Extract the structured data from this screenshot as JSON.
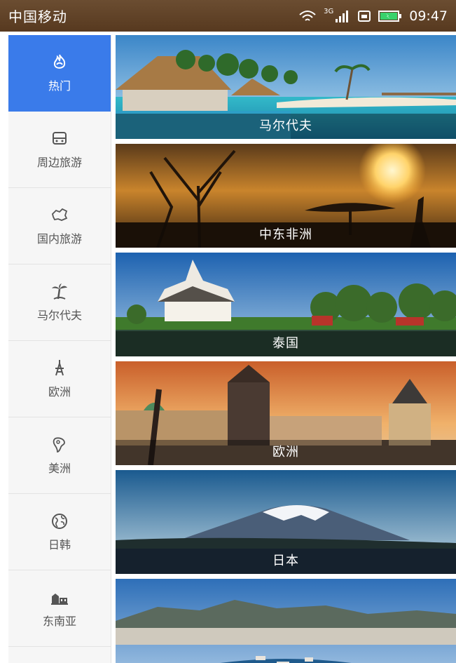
{
  "status": {
    "carrier": "中国移动",
    "network": "3G",
    "time": "09:47"
  },
  "sidebar": {
    "items": [
      {
        "label": "热门",
        "icon": "fire-icon",
        "active": true
      },
      {
        "label": "周边旅游",
        "icon": "bus-icon"
      },
      {
        "label": "国内旅游",
        "icon": "china-map-icon"
      },
      {
        "label": "马尔代夫",
        "icon": "palm-tree-icon"
      },
      {
        "label": "欧洲",
        "icon": "eiffel-tower-icon"
      },
      {
        "label": "美洲",
        "icon": "americas-icon"
      },
      {
        "label": "日韩",
        "icon": "globe-icon"
      },
      {
        "label": "东南亚",
        "icon": "buildings-icon"
      }
    ]
  },
  "destinations": [
    {
      "title": "马尔代夫",
      "image": "maldives-beach-image"
    },
    {
      "title": "中东非洲",
      "image": "africa-sunset-image"
    },
    {
      "title": "泰国",
      "image": "thailand-temple-image"
    },
    {
      "title": "欧洲",
      "image": "prague-bridge-image"
    },
    {
      "title": "日本",
      "image": "mount-fuji-image"
    },
    {
      "title": "",
      "image": "southeast-asia-harbor-image"
    }
  ],
  "colors": {
    "accent": "#3a7bea",
    "statusbar": "#5e4026"
  }
}
